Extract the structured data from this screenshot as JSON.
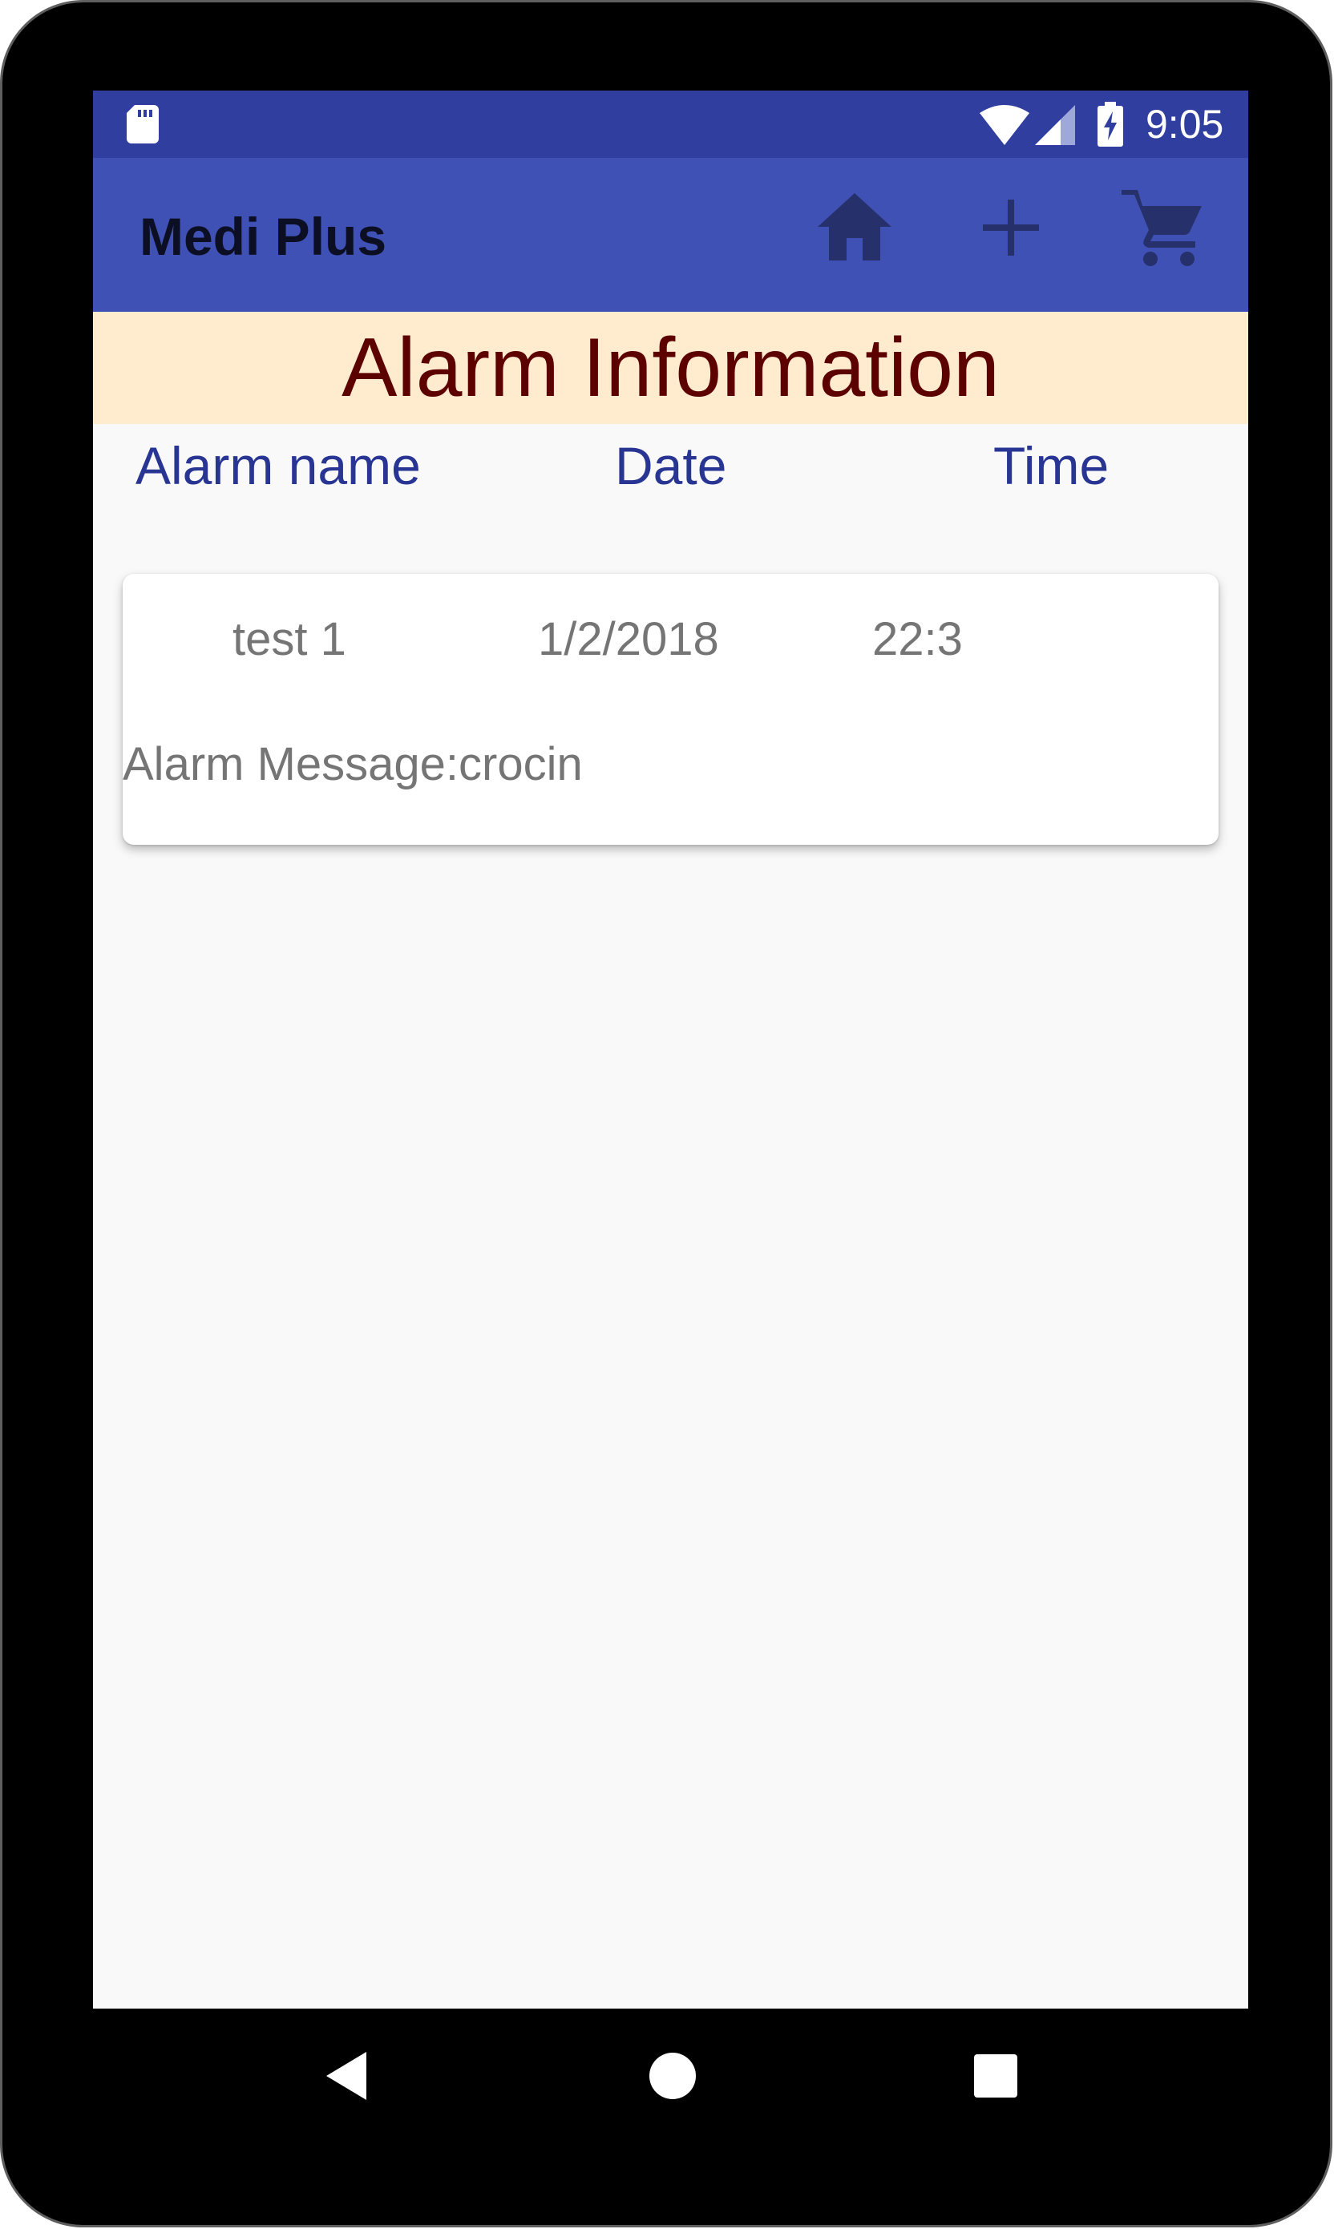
{
  "status_bar": {
    "time": "9:05",
    "icons": [
      "sd-card-icon",
      "wifi-icon",
      "signal-icon",
      "battery-charging-icon"
    ]
  },
  "app_bar": {
    "title": "Medi Plus",
    "actions": [
      "home-icon",
      "add-icon",
      "cart-icon"
    ]
  },
  "section": {
    "title": "Alarm Information"
  },
  "columns": {
    "name": "Alarm name",
    "date": "Date",
    "time": "Time"
  },
  "alarms": [
    {
      "name": "test 1",
      "date": "1/2/2018",
      "time": "22:3",
      "message": "Alarm Message:crocin"
    }
  ],
  "nav_bar": {
    "buttons": [
      "back-icon",
      "home-circle-icon",
      "recent-apps-icon"
    ]
  },
  "colors": {
    "status_bar": "#303f9f",
    "app_bar": "#3f51b5",
    "app_bar_icons": "#26316b",
    "section_header_bg": "#ffebcd",
    "section_title": "#5c0000",
    "column_header": "#283593",
    "card_text": "#757575",
    "screen_bg": "#f9f9f9"
  }
}
